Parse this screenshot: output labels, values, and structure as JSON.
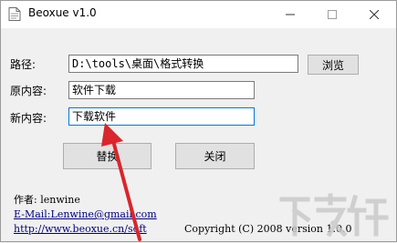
{
  "window": {
    "title": "Beoxue v1.0",
    "app_icon": "document-icon",
    "controls": [
      "minimize-icon",
      "maximize-icon",
      "close-icon"
    ]
  },
  "form": {
    "path_label": "路径:",
    "path_value": "D:\\tools\\桌面\\格式转换",
    "browse_label": "浏览",
    "original_label": "原内容:",
    "original_value": "软件下载",
    "new_label": "新内容:",
    "new_value": "下载软件"
  },
  "actions": {
    "replace_label": "替换",
    "close_label": "关闭"
  },
  "footer": {
    "author": "作者: lenwine",
    "email": "E-Mail:Lenwine@gmail.com",
    "url": "http://www.beoxue.cn/soft",
    "copyright": "Copyright (C) 2008 version 1.0.0"
  },
  "annotation": {
    "arrow_color": "#d9252b"
  }
}
